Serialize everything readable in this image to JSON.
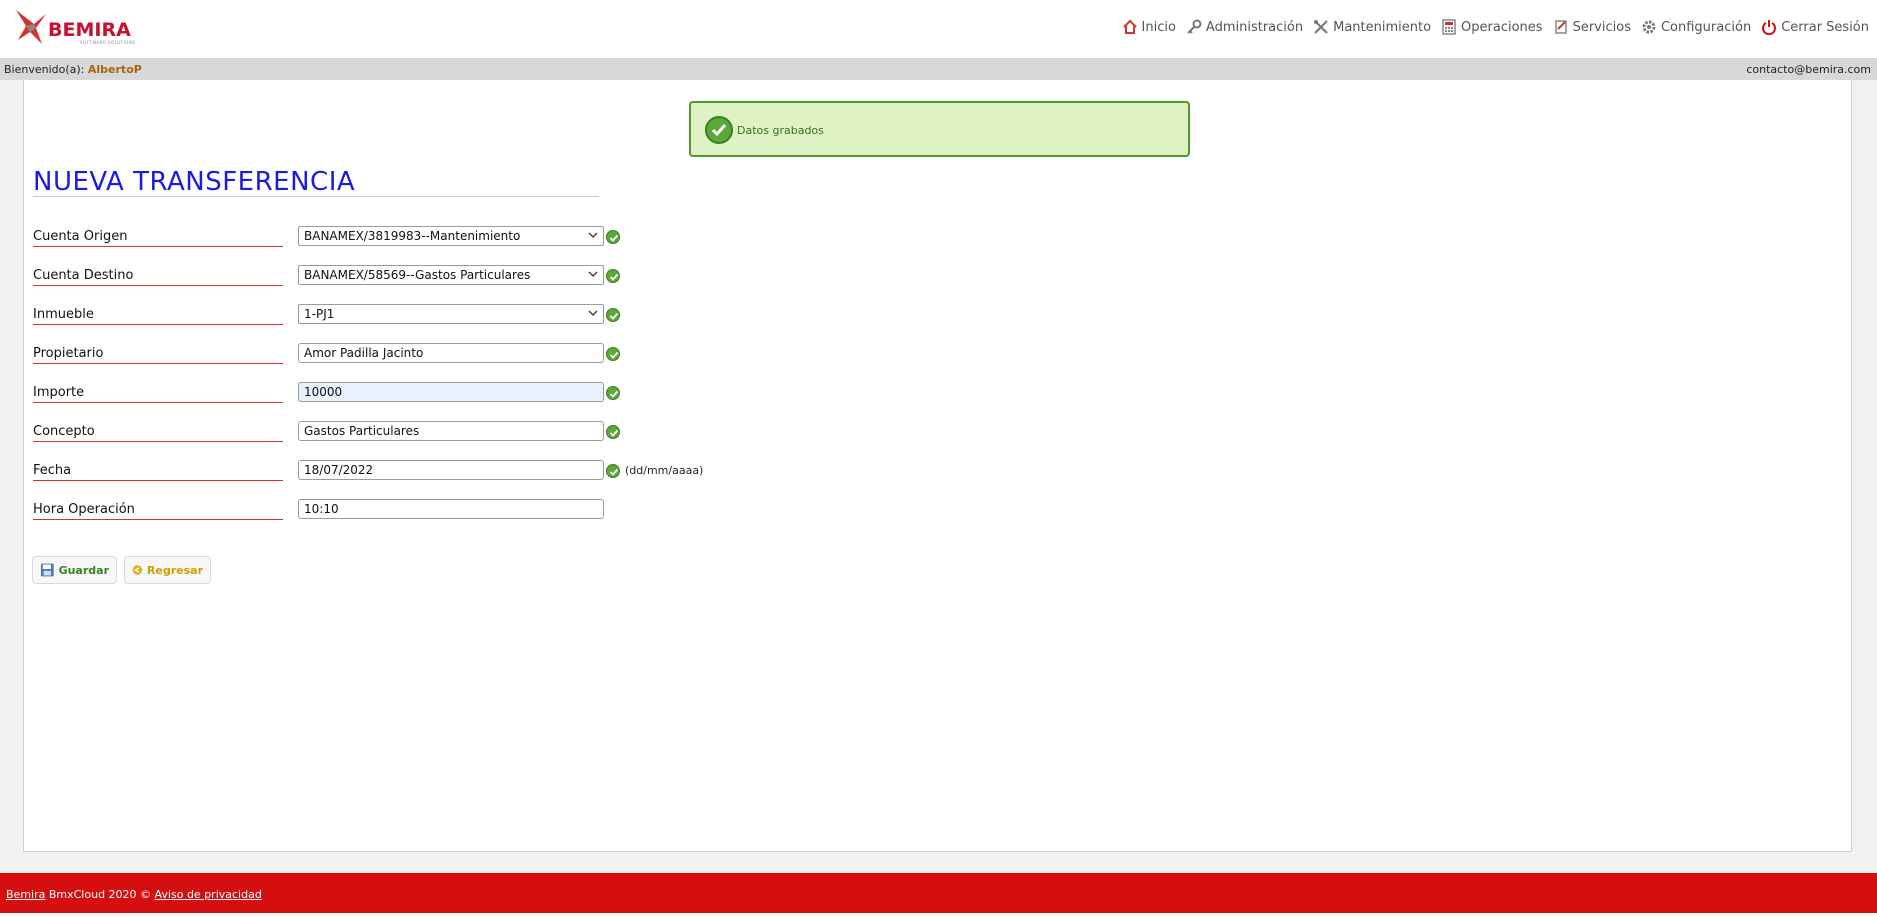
{
  "header": {
    "logo_text": "BEMIRA",
    "logo_sub": "SOFTWARE SOLUTIONS",
    "nav": [
      {
        "label": "Inicio",
        "icon": "home-icon"
      },
      {
        "label": "Administración",
        "icon": "key-icon"
      },
      {
        "label": "Mantenimiento",
        "icon": "tools-icon"
      },
      {
        "label": "Operaciones",
        "icon": "calculator-icon"
      },
      {
        "label": "Servicios",
        "icon": "document-icon"
      },
      {
        "label": "Configuración",
        "icon": "gear-icon"
      },
      {
        "label": "Cerrar Sesión",
        "icon": "power-icon"
      }
    ]
  },
  "welcome": {
    "prefix": "Bienvenido(a):",
    "user": "AlbertoP",
    "email": "contacto@bemira.com"
  },
  "alert": {
    "message": "Datos grabados"
  },
  "form": {
    "title": "NUEVA TRANSFERENCIA",
    "fields": [
      {
        "label": "Cuenta Origen",
        "value": "BANAMEX/3819983--Mantenimiento",
        "type": "select"
      },
      {
        "label": "Cuenta Destino",
        "value": "BANAMEX/58569--Gastos Particulares",
        "type": "select"
      },
      {
        "label": "Inmueble",
        "value": "1-PJ1",
        "type": "select"
      },
      {
        "label": "Propietario",
        "value": "Amor Padilla Jacinto",
        "type": "input"
      },
      {
        "label": "Importe",
        "value": "10000",
        "type": "input"
      },
      {
        "label": "Concepto",
        "value": "Gastos Particulares",
        "type": "input"
      },
      {
        "label": "Fecha",
        "value": "18/07/2022",
        "type": "input",
        "hint": "(dd/mm/aaaa)"
      },
      {
        "label": "Hora Operación",
        "value": "10:10",
        "type": "input"
      }
    ],
    "save_label": "Guardar",
    "back_label": "Regresar"
  },
  "footer": {
    "brand_link": "Bemira",
    "copyright": " BmxCloud 2020 © ",
    "privacy_link": "Aviso de privacidad"
  },
  "colors": {
    "accent_red": "#d50f0f",
    "title_blue": "#1a1ae6",
    "success_green": "#5aa93a"
  }
}
